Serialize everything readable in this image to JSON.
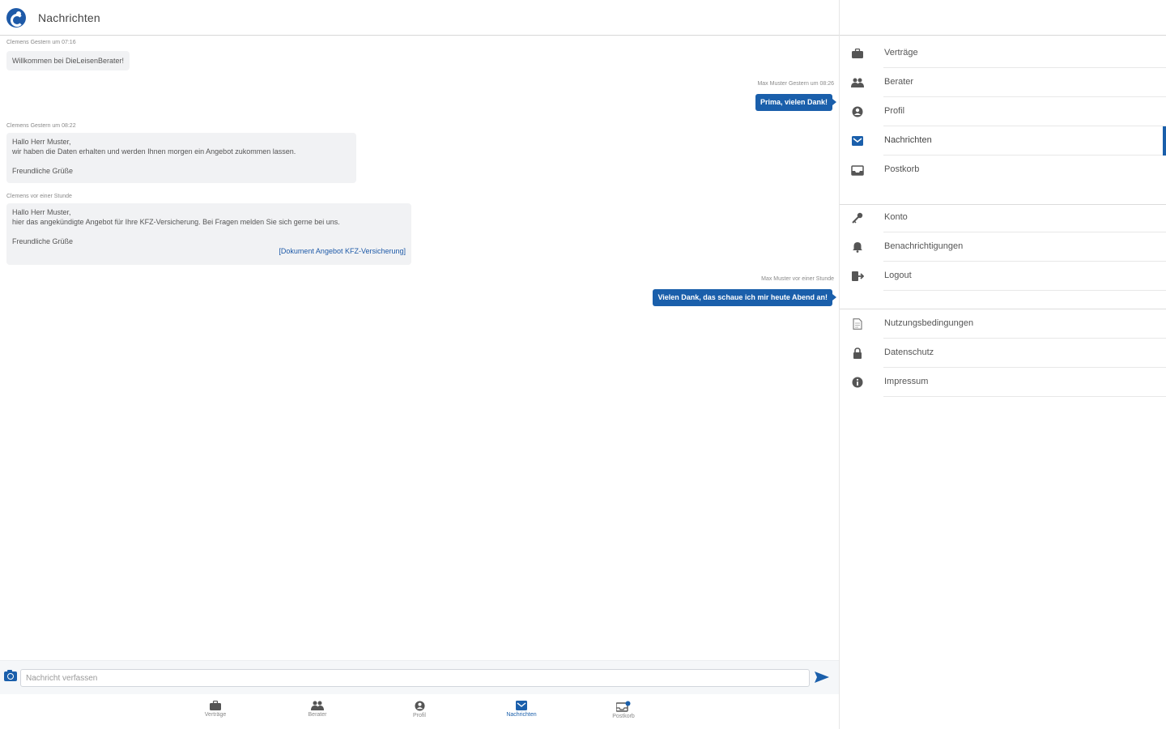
{
  "header": {
    "title": "Nachrichten"
  },
  "messages": [
    {
      "direction": "in",
      "meta": "Clemens Gestern um 07:16",
      "lines": [
        "Willkommen bei DieLeisenBerater!"
      ]
    },
    {
      "direction": "out",
      "meta": "Max Muster Gestern um 08:26",
      "text": "Prima, vielen Dank!"
    },
    {
      "direction": "in",
      "meta": "Clemens Gestern um 08:22",
      "lines": [
        "Hallo Herr Muster,",
        "wir haben die Daten erhalten und werden Ihnen morgen ein Angebot zukommen lassen."
      ],
      "closing": "Freundliche Grüße"
    },
    {
      "direction": "in",
      "meta": "Clemens vor einer Stunde",
      "lines": [
        "Hallo Herr Muster,",
        "hier das angekündigte Angebot für Ihre KFZ-Versicherung. Bei Fragen melden Sie sich gerne bei uns."
      ],
      "closing": "Freundliche Grüße",
      "attachment": "[Dokument Angebot KFZ-Versicherung]"
    },
    {
      "direction": "out",
      "meta": "Max Muster vor einer Stunde",
      "text": "Vielen Dank, das schaue ich mir heute Abend an!"
    }
  ],
  "composer": {
    "placeholder": "Nachricht verfassen"
  },
  "tabs": [
    {
      "label": "Verträge",
      "icon": "briefcase-icon"
    },
    {
      "label": "Berater",
      "icon": "people-icon"
    },
    {
      "label": "Profil",
      "icon": "user-circle-icon"
    },
    {
      "label": "Nachrichten",
      "icon": "mail-icon",
      "active": true
    },
    {
      "label": "Postkorb",
      "icon": "inbox-icon",
      "badge": true
    }
  ],
  "menu": {
    "group1": [
      {
        "label": "Verträge",
        "icon": "briefcase-icon"
      },
      {
        "label": "Berater",
        "icon": "people-icon"
      },
      {
        "label": "Profil",
        "icon": "user-circle-icon"
      },
      {
        "label": "Nachrichten",
        "icon": "mail-icon",
        "active": true
      },
      {
        "label": "Postkorb",
        "icon": "inbox-icon"
      }
    ],
    "group2": [
      {
        "label": "Konto",
        "icon": "key-icon"
      },
      {
        "label": "Benachrichtigungen",
        "icon": "bell-icon"
      },
      {
        "label": "Logout",
        "icon": "logout-icon"
      }
    ],
    "group3": [
      {
        "label": "Nutzungsbedingungen",
        "icon": "document-icon"
      },
      {
        "label": "Datenschutz",
        "icon": "lock-icon"
      },
      {
        "label": "Impressum",
        "icon": "info-icon"
      }
    ]
  },
  "colors": {
    "accent": "#1a5fab",
    "bubble_in": "#f1f2f4",
    "composer_bg": "#f5f7f9"
  }
}
